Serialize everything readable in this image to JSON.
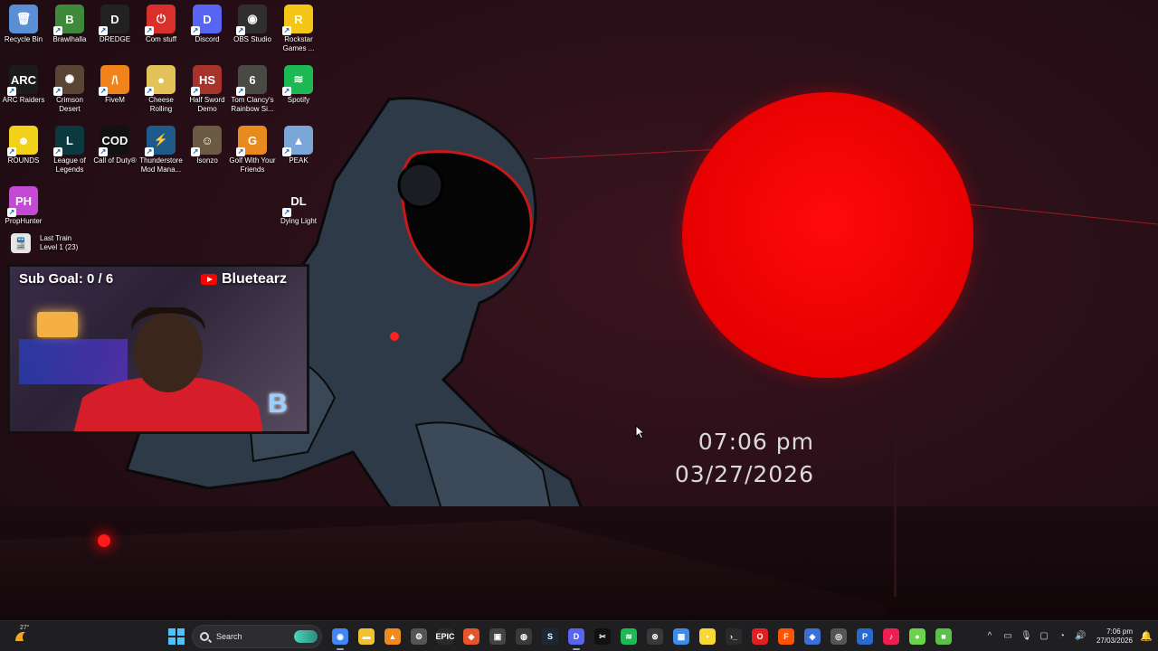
{
  "desktop": {
    "icons": [
      {
        "label": "Recycle Bin",
        "glyph": "🗑",
        "color": "#5a8fd6",
        "icon": "recycle-bin-icon"
      },
      {
        "label": "Brawlhalla",
        "glyph": "B",
        "color": "#3e8a3a",
        "icon": "brawlhalla-icon"
      },
      {
        "label": "DREDGE",
        "glyph": "D",
        "color": "#222222",
        "icon": "dredge-icon"
      },
      {
        "label": "Com stuff",
        "glyph": "⏻",
        "color": "#d9302c",
        "icon": "com-stuff-icon"
      },
      {
        "label": "Discord",
        "glyph": "D",
        "color": "#5865f2",
        "icon": "discord-icon"
      },
      {
        "label": "OBS Studio",
        "glyph": "◉",
        "color": "#302e31",
        "icon": "obs-icon"
      },
      {
        "label": "Rockstar Games ...",
        "glyph": "R",
        "color": "#f5c518",
        "icon": "rockstar-icon"
      },
      {
        "label": "ARC Raiders",
        "glyph": "ARC",
        "color": "#1c1c1c",
        "icon": "arc-raiders-icon"
      },
      {
        "label": "Crimson Desert",
        "glyph": "✺",
        "color": "#5a4433",
        "icon": "crimson-desert-icon"
      },
      {
        "label": "FiveM",
        "glyph": "/\\",
        "color": "#f0841a",
        "icon": "fivem-icon"
      },
      {
        "label": "Cheese Rolling",
        "glyph": "●",
        "color": "#e3c25a",
        "icon": "cheese-rolling-icon"
      },
      {
        "label": "Half Sword Demo",
        "glyph": "HS",
        "color": "#a8322c",
        "icon": "half-sword-icon"
      },
      {
        "label": "Tom Clancy's Rainbow Si...",
        "glyph": "6",
        "color": "#4a4a44",
        "icon": "rainbow-six-icon"
      },
      {
        "label": "Spotify",
        "glyph": "≋",
        "color": "#1db954",
        "icon": "spotify-icon"
      },
      {
        "label": "ROUNDS",
        "glyph": "☻",
        "color": "#f2d11a",
        "icon": "rounds-icon"
      },
      {
        "label": "League of Legends",
        "glyph": "L",
        "color": "#0a3a3f",
        "icon": "league-icon"
      },
      {
        "label": "Call of Duty®",
        "glyph": "COD",
        "color": "#111111",
        "icon": "call-of-duty-icon"
      },
      {
        "label": "Thunderstore Mod Mana...",
        "glyph": "⚡",
        "color": "#1f5b8a",
        "icon": "thunderstore-icon"
      },
      {
        "label": "Isonzo",
        "glyph": "☺",
        "color": "#6b5a44",
        "icon": "isonzo-icon"
      },
      {
        "label": "Golf With Your Friends",
        "glyph": "G",
        "color": "#e98a1f",
        "icon": "golf-icon"
      },
      {
        "label": "PEAK",
        "glyph": "▲",
        "color": "#7aa7d8",
        "icon": "peak-icon"
      },
      {
        "label": "PropHunter",
        "glyph": "PH",
        "color": "#c44ad6",
        "icon": "prophunter-icon"
      },
      {
        "label": "Dying Light",
        "glyph": "DL",
        "color": "transparent",
        "icon": "dying-light-icon"
      }
    ],
    "last_train": {
      "line1": "Last Train",
      "line2": "Level 1 (23)"
    }
  },
  "webcam": {
    "sub_goal": "Sub Goal: 0 / 6",
    "channel": "Bluetearz"
  },
  "clock_widget": {
    "time": "07:06 pm",
    "date": "03/27/2026"
  },
  "taskbar": {
    "weather_temp": "27°",
    "search_placeholder": "Search",
    "apps": [
      {
        "name": "chrome",
        "glyph": "◉",
        "color": "#4285f4",
        "active": true
      },
      {
        "name": "file-explorer",
        "glyph": "▬",
        "color": "#f2c12e",
        "active": false
      },
      {
        "name": "vlc",
        "glyph": "▲",
        "color": "#f08a1d",
        "active": false
      },
      {
        "name": "steam-tools",
        "glyph": "⚙",
        "color": "#555555",
        "active": false
      },
      {
        "name": "epic-games",
        "glyph": "EPIC",
        "color": "#2a2a2a",
        "active": false
      },
      {
        "name": "brave",
        "glyph": "◆",
        "color": "#e5542a",
        "active": false
      },
      {
        "name": "game-launcher",
        "glyph": "▣",
        "color": "#444444",
        "active": false
      },
      {
        "name": "obs",
        "glyph": "◍",
        "color": "#3a3a3a",
        "active": false
      },
      {
        "name": "steam",
        "glyph": "S",
        "color": "#1b2838",
        "active": false
      },
      {
        "name": "discord",
        "glyph": "D",
        "color": "#5865f2",
        "active": true
      },
      {
        "name": "capcut",
        "glyph": "✂",
        "color": "#111111",
        "active": false
      },
      {
        "name": "spotify",
        "glyph": "≋",
        "color": "#1db954",
        "active": false
      },
      {
        "name": "xbox",
        "glyph": "⊗",
        "color": "#3a3a3a",
        "active": false
      },
      {
        "name": "photos",
        "glyph": "▦",
        "color": "#3d8be8",
        "active": false
      },
      {
        "name": "sticky-notes",
        "glyph": "▪",
        "color": "#f7d936",
        "active": false
      },
      {
        "name": "terminal",
        "glyph": "›_",
        "color": "#2b2b2b",
        "active": false
      },
      {
        "name": "opera",
        "glyph": "O",
        "color": "#e02020",
        "active": false
      },
      {
        "name": "faceit",
        "glyph": "F",
        "color": "#ff5500",
        "active": false
      },
      {
        "name": "vpn",
        "glyph": "◈",
        "color": "#3b6fd8",
        "active": false
      },
      {
        "name": "nvidia",
        "glyph": "◎",
        "color": "#555555",
        "active": false
      },
      {
        "name": "paint",
        "glyph": "P",
        "color": "#2a6ad0",
        "active": false
      },
      {
        "name": "tiktok",
        "glyph": "♪",
        "color": "#ee1d52",
        "active": false
      },
      {
        "name": "chat",
        "glyph": "●",
        "color": "#6bd44c",
        "active": false
      },
      {
        "name": "roblox",
        "glyph": "■",
        "color": "#5cc04a",
        "active": false
      }
    ],
    "tray": {
      "time": "7:06 pm",
      "date": "27/03/2026"
    }
  }
}
